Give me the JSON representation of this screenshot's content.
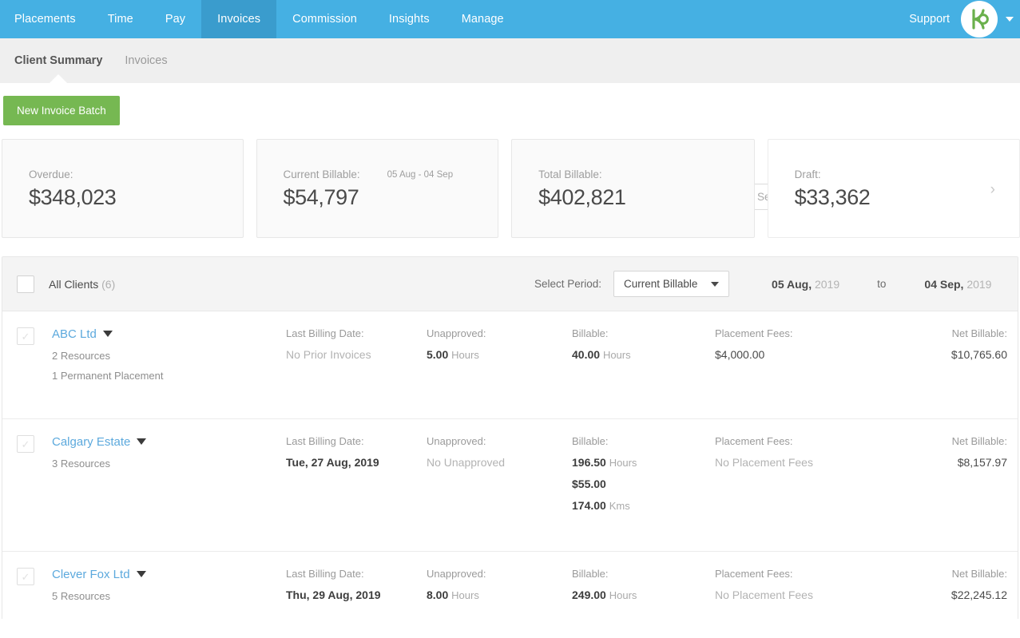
{
  "topnav": {
    "items": [
      {
        "label": "Placements",
        "active": false
      },
      {
        "label": "Time",
        "active": false
      },
      {
        "label": "Pay",
        "active": false
      },
      {
        "label": "Invoices",
        "active": true
      },
      {
        "label": "Commission",
        "active": false
      },
      {
        "label": "Insights",
        "active": false
      },
      {
        "label": "Manage",
        "active": false
      }
    ],
    "support_label": "Support",
    "avatar_letter": "K",
    "accent_color": "#45b0e3",
    "active_tab_color": "#3a9ccd",
    "logo_color": "#6ab04c"
  },
  "subnav": {
    "tabs": [
      {
        "label": "Client Summary",
        "active": true
      },
      {
        "label": "Invoices",
        "active": false
      }
    ]
  },
  "actionbar": {
    "new_batch_label": "New Invoice Batch",
    "new_batch_color": "#76b852",
    "search_placeholder": "Search Clients",
    "search_value": ""
  },
  "cards": [
    {
      "label": "Overdue:",
      "value": "$348,023",
      "daterange": "",
      "chevron": false
    },
    {
      "label": "Current Billable:",
      "value": "$54,797",
      "daterange": "05 Aug - 04 Sep",
      "chevron": false
    },
    {
      "label": "Total Billable:",
      "value": "$402,821",
      "daterange": "",
      "chevron": false
    },
    {
      "label": "Draft:",
      "value": "$33,362",
      "daterange": "",
      "chevron": true
    }
  ],
  "filterbar": {
    "all_clients_label": "All Clients",
    "all_clients_count": "(6)",
    "select_period_label": "Select Period:",
    "period_value": "Current Billable",
    "date_from_day": "05 Aug,",
    "date_from_year": "2019",
    "to_label": "to",
    "date_to_day": "04 Sep,",
    "date_to_year": "2019"
  },
  "columns": {
    "last_billing_date": "Last Billing Date:",
    "unapproved": "Unapproved:",
    "billable": "Billable:",
    "placement_fees": "Placement Fees:",
    "net_billable": "Net Billable:"
  },
  "rows": [
    {
      "name": "ABC Ltd",
      "resources": "2 Resources",
      "extra": "1 Permanent Placement",
      "last_billing_date": "No Prior Invoices",
      "last_billing_muted": true,
      "unapproved_value": "5.00",
      "unapproved_unit": "Hours",
      "unapproved_muted": false,
      "billable_lines": [
        {
          "value": "40.00",
          "unit": "Hours"
        }
      ],
      "placement_fees": "$4,000.00",
      "placement_fees_muted": false,
      "net_billable": "$10,765.60"
    },
    {
      "name": "Calgary Estate",
      "resources": "3 Resources",
      "extra": "",
      "last_billing_date": "Tue, 27 Aug, 2019",
      "last_billing_muted": false,
      "unapproved_value": "No Unapproved",
      "unapproved_unit": "",
      "unapproved_muted": true,
      "billable_lines": [
        {
          "value": "196.50",
          "unit": "Hours"
        },
        {
          "value": "$55.00",
          "unit": ""
        },
        {
          "value": "174.00",
          "unit": "Kms"
        }
      ],
      "placement_fees": "No Placement Fees",
      "placement_fees_muted": true,
      "net_billable": "$8,157.97"
    },
    {
      "name": "Clever Fox Ltd",
      "resources": "5 Resources",
      "extra": "",
      "last_billing_date": "Thu, 29 Aug, 2019",
      "last_billing_muted": false,
      "unapproved_value": "8.00",
      "unapproved_unit": "Hours",
      "unapproved_muted": false,
      "billable_lines": [
        {
          "value": "249.00",
          "unit": "Hours"
        }
      ],
      "placement_fees": "No Placement Fees",
      "placement_fees_muted": true,
      "net_billable": "$22,245.12"
    }
  ]
}
